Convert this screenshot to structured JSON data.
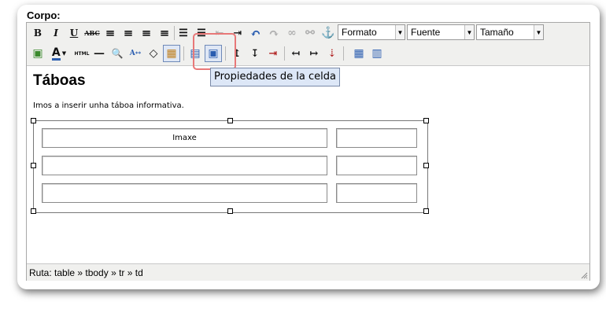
{
  "section_label": "Corpo:",
  "toolbar": {
    "row1": [
      {
        "name": "bold-button",
        "glyph": "B"
      },
      {
        "name": "italic-button",
        "glyph": "I"
      },
      {
        "name": "underline-button",
        "glyph": "U"
      },
      {
        "name": "strikethrough-button",
        "glyph": "ABC"
      },
      {
        "name": "align-left-button",
        "glyph": "≡"
      },
      {
        "name": "align-center-button",
        "glyph": "≡"
      },
      {
        "name": "align-right-button",
        "glyph": "≡"
      },
      {
        "name": "align-justify-button",
        "glyph": "≡"
      },
      {
        "name": "bullet-list-button",
        "glyph": "☰"
      },
      {
        "name": "numbered-list-button",
        "glyph": "☰"
      },
      {
        "name": "outdent-button",
        "glyph": "⇤"
      },
      {
        "name": "indent-button",
        "glyph": "⇥"
      },
      {
        "name": "undo-button",
        "glyph": "↶"
      },
      {
        "name": "redo-button",
        "glyph": "↷"
      },
      {
        "name": "link-button",
        "glyph": "∞"
      },
      {
        "name": "unlink-button",
        "glyph": "⚯"
      },
      {
        "name": "anchor-button",
        "glyph": "⚓"
      }
    ],
    "format_select": "Formato",
    "font_select": "Fuente",
    "size_select": "Tamaño",
    "row2_glyphs": {
      "image": "▣",
      "text_color": "A",
      "html": "HTML",
      "hr": "—",
      "find": "🔍",
      "replace": "A↔",
      "clean": "◇",
      "visual_aid": "▦",
      "row_props": "▤",
      "cell_props": "▣",
      "insert_row_before": "↥",
      "insert_row_after": "↧",
      "delete_row": "⇥",
      "insert_col_before": "↤",
      "insert_col_after": "↦",
      "delete_col": "⇣",
      "split_cells": "▦",
      "merge_cells": "▥"
    }
  },
  "document": {
    "heading": "Táboas",
    "intro": "Imos a inserir unha táboa informativa.",
    "table_cell_1": "Imaxe"
  },
  "tooltip": "Propiedades de la celda",
  "statusbar": {
    "path": "Ruta: table » tbody » tr » td"
  },
  "colors": {
    "toolbar_bg": "#f0f0ee",
    "highlight": "#e87878",
    "tooltip_bg": "#dde7f7",
    "undo_blue": "#2a5db0"
  }
}
